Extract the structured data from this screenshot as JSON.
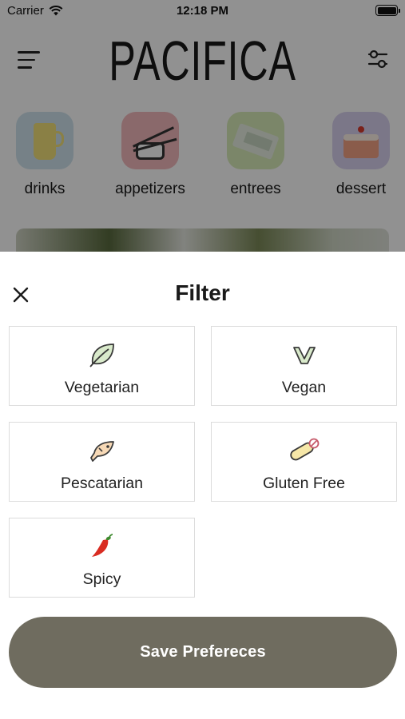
{
  "status_bar": {
    "carrier": "Carrier",
    "time": "12:18 PM"
  },
  "header": {
    "brand": "PACIFICA"
  },
  "categories": [
    {
      "label": "drinks",
      "icon": "drink-icon"
    },
    {
      "label": "appetizers",
      "icon": "sushi-icon"
    },
    {
      "label": "entrees",
      "icon": "entree-icon"
    },
    {
      "label": "dessert",
      "icon": "cake-icon"
    }
  ],
  "filter_sheet": {
    "title": "Filter",
    "options": [
      {
        "label": "Vegetarian",
        "icon": "leaf-icon"
      },
      {
        "label": "Vegan",
        "icon": "vegan-icon"
      },
      {
        "label": "Pescatarian",
        "icon": "fish-icon"
      },
      {
        "label": "Gluten Free",
        "icon": "bread-icon"
      },
      {
        "label": "Spicy",
        "icon": "chili-pepper-icon"
      }
    ],
    "save_label": "Save Prefereces"
  },
  "colors": {
    "save_button": "#6f6c5f",
    "overlay": "rgba(0,0,0,0.43)",
    "option_border": "#dcdcdc"
  }
}
